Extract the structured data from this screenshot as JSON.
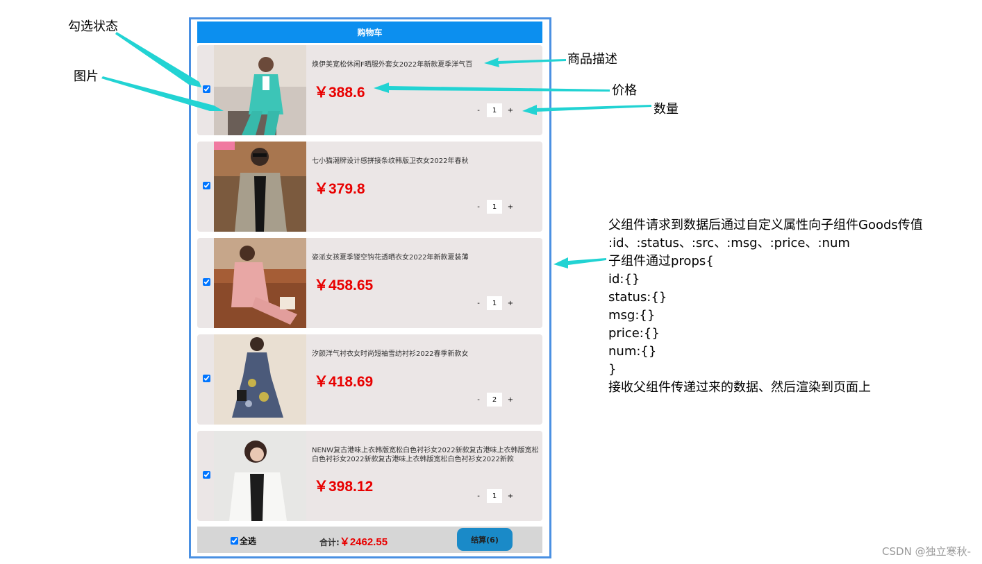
{
  "cart": {
    "title": "购物车",
    "items": [
      {
        "desc": "焕伊美宽松休闲F晒服外套女2022年新款夏季洋气百",
        "price": "￥388.6",
        "qty": "1",
        "minus": "-",
        "plus": "+"
      },
      {
        "desc": "七小猫潮牌设计感拼接条纹韩版卫衣女2022年春秋",
        "price": "￥379.8",
        "qty": "1",
        "minus": "-",
        "plus": "+"
      },
      {
        "desc": "姿派女孩夏季镂空钩花透晒衣女2022年新款夏装薄",
        "price": "￥458.65",
        "qty": "1",
        "minus": "-",
        "plus": "+"
      },
      {
        "desc": "汐颜洋气衬衣女时尚短袖雪纺衬衫2022春季新款女",
        "price": "￥418.69",
        "qty": "2",
        "minus": "-",
        "plus": "+"
      },
      {
        "desc": "NENW复古港味上衣韩版宽松白色衬衫女2022新款复古港味上衣韩版宽松白色衬衫女2022新款复古港味上衣韩版宽松白色衬衫女2022新款",
        "price": "￥398.12",
        "qty": "1",
        "minus": "-",
        "plus": "+"
      }
    ],
    "footer": {
      "select_all": "全选",
      "total_label": "合计:",
      "total_amount": "￥2462.55",
      "settle": "结算(6)"
    }
  },
  "annotations": {
    "check_state": "勾选状态",
    "image": "图片",
    "product_desc": "商品描述",
    "price": "价格",
    "quantity": "数量"
  },
  "explanation": [
    "父组件请求到数据后通过自定义属性向子组件Goods传值",
    ":id、:status、:src、:msg、:price、:num",
    "子组件通过props{",
    "id:{}",
    "status:{}",
    "msg:{}",
    "price:{}",
    "num:{}",
    "}",
    "接收父组件传递过来的数据、然后渲染到页面上"
  ],
  "watermark": "CSDN @独立寒秋-",
  "colors": {
    "header": "#0c8fef",
    "price": "#e80000",
    "arrow": "#22d3d3",
    "frame": "#4a90e2",
    "settle": "#1a8ac8"
  }
}
